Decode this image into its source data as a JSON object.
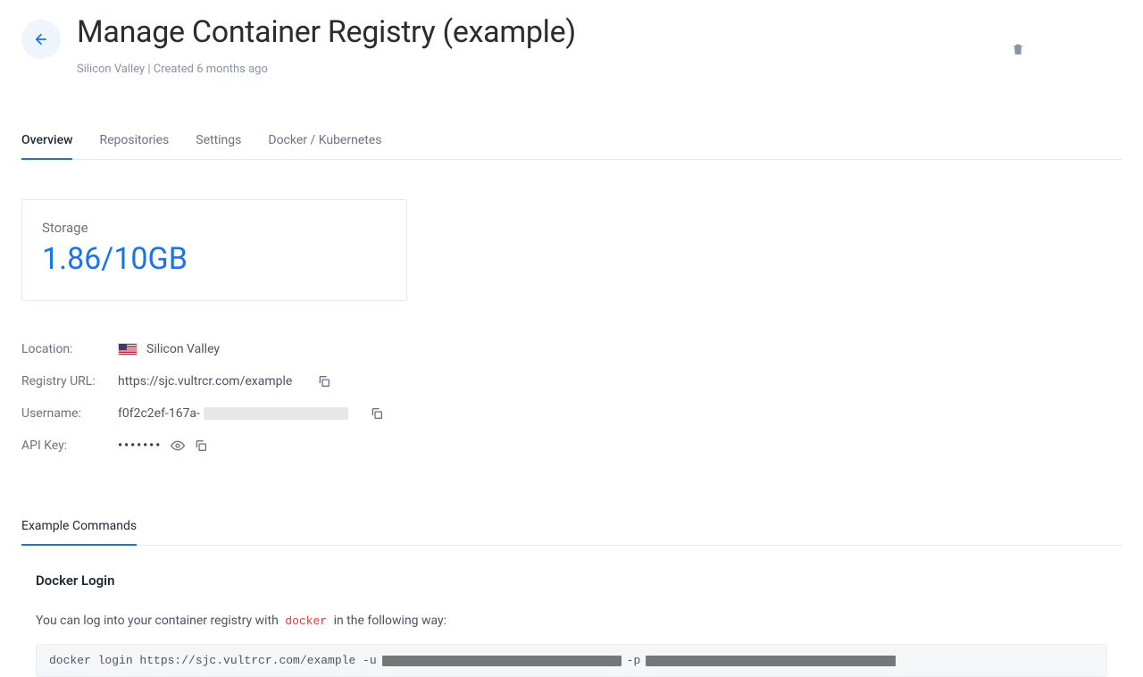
{
  "header": {
    "title": "Manage Container Registry (example)",
    "subtitle": "Silicon Valley | Created 6 months ago"
  },
  "tabs": [
    {
      "label": "Overview",
      "active": true
    },
    {
      "label": "Repositories",
      "active": false
    },
    {
      "label": "Settings",
      "active": false
    },
    {
      "label": "Docker / Kubernetes",
      "active": false
    }
  ],
  "storage": {
    "label": "Storage",
    "value": "1.86/10GB"
  },
  "details": {
    "location_label": "Location:",
    "location_value": "Silicon Valley",
    "registry_url_label": "Registry URL:",
    "registry_url_value": "https://sjc.vultrcr.com/example",
    "username_label": "Username:",
    "username_prefix": "f0f2c2ef-167a-",
    "apikey_label": "API Key:",
    "apikey_masked": "•••••••"
  },
  "sub_tabs": {
    "example_commands": "Example Commands"
  },
  "docker_login": {
    "title": "Docker Login",
    "desc_prefix": "You can log into your container registry with",
    "desc_code": "docker",
    "desc_suffix": "in the following way:",
    "cmd_prefix": "docker login https://sjc.vultrcr.com/example -u",
    "cmd_flag_p": "-p"
  }
}
